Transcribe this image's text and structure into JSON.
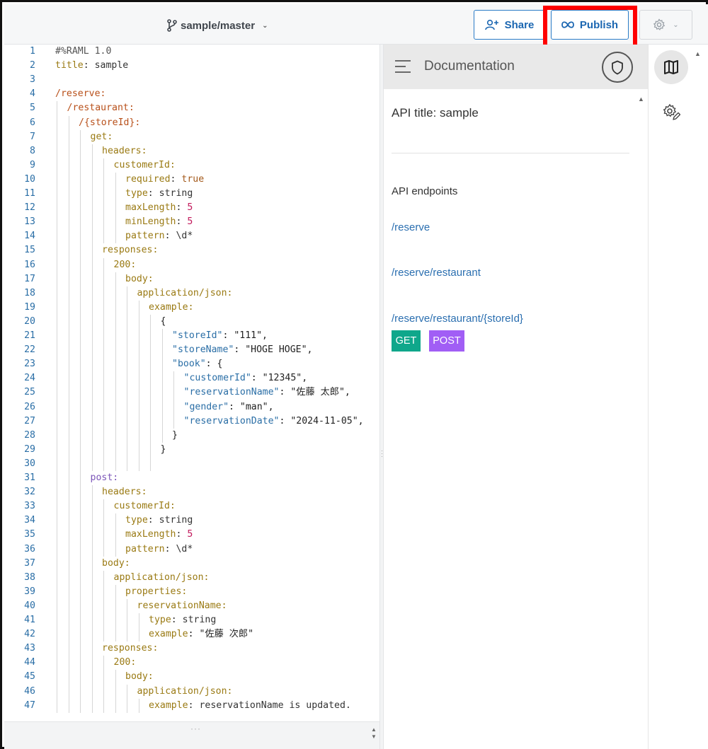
{
  "topbar": {
    "branch": "sample/master",
    "share_label": "Share",
    "publish_label": "Publish",
    "icons": {
      "branch": "git-branch-icon",
      "share": "user-plus-icon",
      "publish": "infinity-icon",
      "settings": "gear-icon"
    }
  },
  "editor": {
    "lines": [
      {
        "n": "1",
        "i": 0,
        "t": [
          [
            "#%RAML 1.0",
            "com"
          ]
        ]
      },
      {
        "n": "2",
        "i": 0,
        "t": [
          [
            "title",
            "olive"
          ],
          [
            ": sample",
            "plain"
          ]
        ]
      },
      {
        "n": "3",
        "i": 0,
        "t": []
      },
      {
        "n": "4",
        "i": 0,
        "t": [
          [
            "/reserve:",
            "route"
          ]
        ]
      },
      {
        "n": "5",
        "i": 1,
        "t": [
          [
            "/restaurant:",
            "route"
          ]
        ]
      },
      {
        "n": "6",
        "i": 2,
        "t": [
          [
            "/{storeId}:",
            "route"
          ]
        ]
      },
      {
        "n": "7",
        "i": 3,
        "t": [
          [
            "get:",
            "olive"
          ]
        ]
      },
      {
        "n": "8",
        "i": 4,
        "t": [
          [
            "headers:",
            "olive"
          ]
        ]
      },
      {
        "n": "9",
        "i": 5,
        "t": [
          [
            "customerId:",
            "olive"
          ]
        ]
      },
      {
        "n": "10",
        "i": 6,
        "t": [
          [
            "required",
            "olive"
          ],
          [
            ": ",
            "plain"
          ],
          [
            "true",
            "bool"
          ]
        ]
      },
      {
        "n": "11",
        "i": 6,
        "t": [
          [
            "type",
            "olive"
          ],
          [
            ": string",
            "plain"
          ]
        ]
      },
      {
        "n": "12",
        "i": 6,
        "t": [
          [
            "maxLength",
            "olive"
          ],
          [
            ": ",
            "plain"
          ],
          [
            "5",
            "num"
          ]
        ]
      },
      {
        "n": "13",
        "i": 6,
        "t": [
          [
            "minLength",
            "olive"
          ],
          [
            ": ",
            "plain"
          ],
          [
            "5",
            "num"
          ]
        ]
      },
      {
        "n": "14",
        "i": 6,
        "t": [
          [
            "pattern",
            "olive"
          ],
          [
            ": \\d*",
            "plain"
          ]
        ]
      },
      {
        "n": "15",
        "i": 4,
        "t": [
          [
            "responses:",
            "olive"
          ]
        ]
      },
      {
        "n": "16",
        "i": 5,
        "t": [
          [
            "200:",
            "olive"
          ]
        ]
      },
      {
        "n": "17",
        "i": 6,
        "t": [
          [
            "body:",
            "olive"
          ]
        ]
      },
      {
        "n": "18",
        "i": 7,
        "t": [
          [
            "application/json:",
            "olive"
          ]
        ]
      },
      {
        "n": "19",
        "i": 8,
        "t": [
          [
            "example:",
            "olive"
          ]
        ]
      },
      {
        "n": "20",
        "i": 9,
        "t": [
          [
            "{",
            "str"
          ]
        ]
      },
      {
        "n": "21",
        "i": 10,
        "t": [
          [
            "\"storeId\"",
            "jkey"
          ],
          [
            ": \"111\",",
            "str"
          ]
        ]
      },
      {
        "n": "22",
        "i": 10,
        "t": [
          [
            "\"storeName\"",
            "jkey"
          ],
          [
            ": \"HOGE HOGE\",",
            "str"
          ]
        ]
      },
      {
        "n": "23",
        "i": 10,
        "t": [
          [
            "\"book\"",
            "jkey"
          ],
          [
            ": {",
            "str"
          ]
        ]
      },
      {
        "n": "24",
        "i": 11,
        "t": [
          [
            "\"customerId\"",
            "jkey"
          ],
          [
            ": \"12345\",",
            "str"
          ]
        ]
      },
      {
        "n": "25",
        "i": 11,
        "t": [
          [
            "\"reservationName\"",
            "jkey"
          ],
          [
            ": \"佐藤 太郎\",",
            "str"
          ]
        ]
      },
      {
        "n": "26",
        "i": 11,
        "t": [
          [
            "\"gender\"",
            "jkey"
          ],
          [
            ": \"man\",",
            "str"
          ]
        ]
      },
      {
        "n": "27",
        "i": 11,
        "t": [
          [
            "\"reservationDate\"",
            "jkey"
          ],
          [
            ": \"2024-11-05\",",
            "str"
          ]
        ]
      },
      {
        "n": "28",
        "i": 10,
        "t": [
          [
            "}",
            "str"
          ]
        ]
      },
      {
        "n": "29",
        "i": 9,
        "t": [
          [
            "}",
            "str"
          ]
        ]
      },
      {
        "n": "30",
        "i": 0,
        "t": []
      },
      {
        "n": "31",
        "i": 3,
        "t": [
          [
            "post:",
            "purple"
          ]
        ]
      },
      {
        "n": "32",
        "i": 4,
        "t": [
          [
            "headers:",
            "olive"
          ]
        ]
      },
      {
        "n": "33",
        "i": 5,
        "t": [
          [
            "customerId:",
            "olive"
          ]
        ]
      },
      {
        "n": "34",
        "i": 6,
        "t": [
          [
            "type",
            "olive"
          ],
          [
            ": string",
            "plain"
          ]
        ]
      },
      {
        "n": "35",
        "i": 6,
        "t": [
          [
            "maxLength",
            "olive"
          ],
          [
            ": ",
            "plain"
          ],
          [
            "5",
            "num"
          ]
        ]
      },
      {
        "n": "36",
        "i": 6,
        "t": [
          [
            "pattern",
            "olive"
          ],
          [
            ": \\d*",
            "plain"
          ]
        ]
      },
      {
        "n": "37",
        "i": 4,
        "t": [
          [
            "body:",
            "olive"
          ]
        ]
      },
      {
        "n": "38",
        "i": 5,
        "t": [
          [
            "application/json:",
            "olive"
          ]
        ]
      },
      {
        "n": "39",
        "i": 6,
        "t": [
          [
            "properties:",
            "olive"
          ]
        ]
      },
      {
        "n": "40",
        "i": 7,
        "t": [
          [
            "reservationName:",
            "olive"
          ]
        ]
      },
      {
        "n": "41",
        "i": 8,
        "t": [
          [
            "type",
            "olive"
          ],
          [
            ": string",
            "plain"
          ]
        ]
      },
      {
        "n": "42",
        "i": 8,
        "t": [
          [
            "example",
            "olive"
          ],
          [
            ": \"佐藤 次郎\"",
            "str"
          ]
        ]
      },
      {
        "n": "43",
        "i": 4,
        "t": [
          [
            "responses:",
            "olive"
          ]
        ]
      },
      {
        "n": "44",
        "i": 5,
        "t": [
          [
            "200:",
            "olive"
          ]
        ]
      },
      {
        "n": "45",
        "i": 6,
        "t": [
          [
            "body:",
            "olive"
          ]
        ]
      },
      {
        "n": "46",
        "i": 7,
        "t": [
          [
            "application/json:",
            "olive"
          ]
        ]
      },
      {
        "n": "47",
        "i": 8,
        "t": [
          [
            "example",
            "olive"
          ],
          [
            ": reservationName is updated.",
            "plain"
          ]
        ]
      }
    ]
  },
  "docs": {
    "header_title": "Documentation",
    "api_title": "API title: sample",
    "endpoints_label": "API endpoints",
    "endpoints": [
      "/reserve",
      "/reserve/restaurant",
      "/reserve/restaurant/{storeId}"
    ],
    "methods": [
      "GET",
      "POST"
    ],
    "icons": {
      "menu": "hamburger-icon",
      "shield": "shield-icon"
    }
  },
  "rail": {
    "icons": [
      "book-map-icon",
      "gear-pencil-icon"
    ]
  },
  "colors": {
    "get_badge": "#0fa78b",
    "post_badge": "#a15ef5",
    "link": "#2b6fb0",
    "highlight_box": "#ff0000"
  }
}
